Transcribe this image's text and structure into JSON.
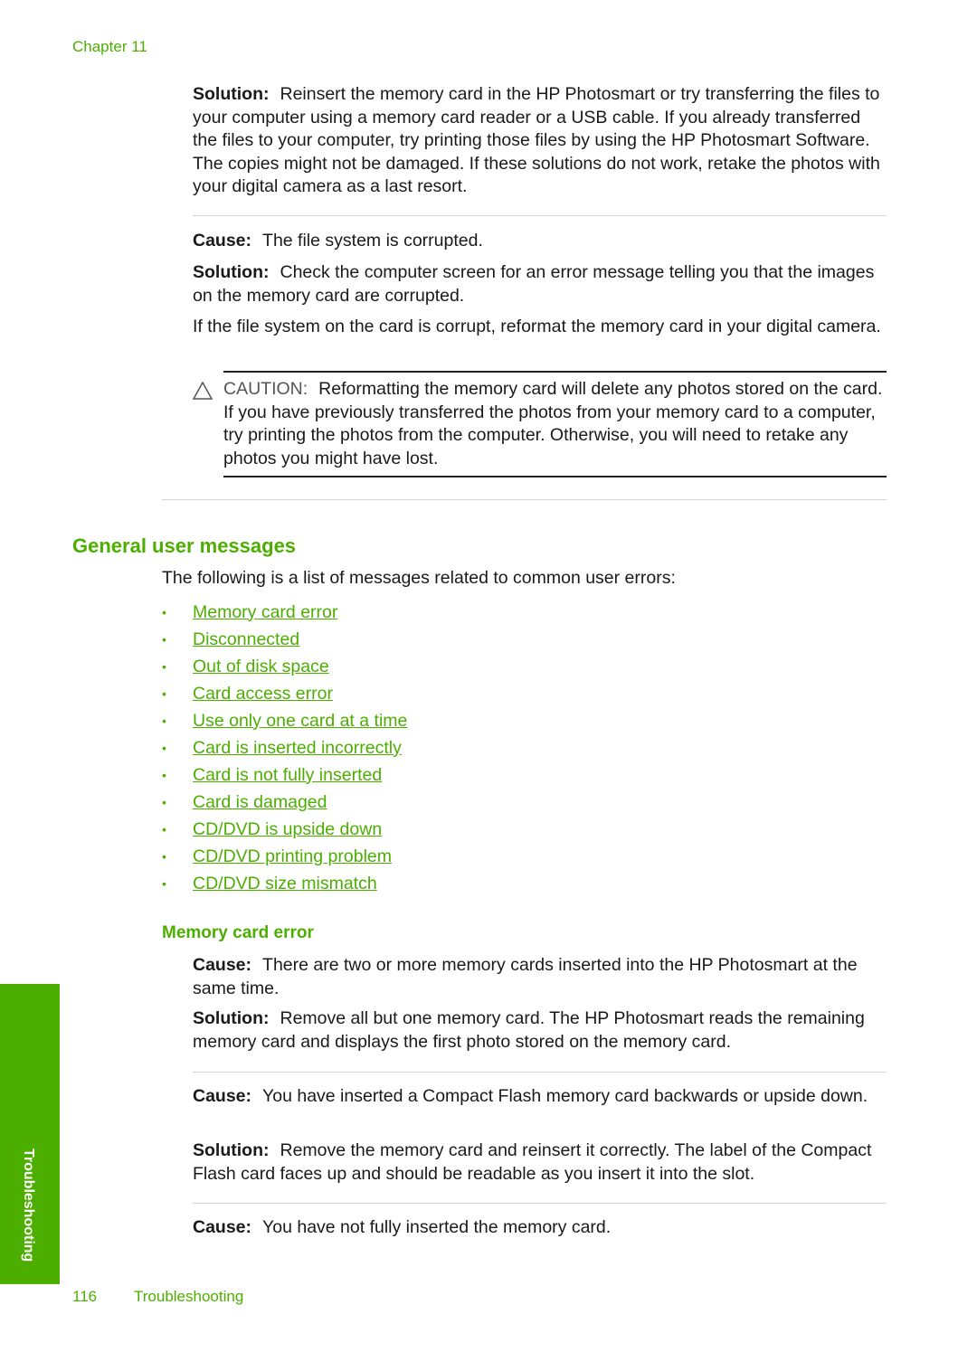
{
  "header": {
    "chapter": "Chapter 11"
  },
  "top_solution": {
    "label": "Solution:",
    "text": "Reinsert the memory card in the HP Photosmart or try transferring the files to your computer using a memory card reader or a USB cable. If you already transferred the files to your computer, try printing those files by using the HP Photosmart Software. The copies might not be damaged. If these solutions do not work, retake the photos with your digital camera as a last resort."
  },
  "cause2": {
    "label": "Cause:",
    "text": "The file system is corrupted."
  },
  "solution2": {
    "label": "Solution:",
    "text": "Check the computer screen for an error message telling you that the images on the memory card are corrupted."
  },
  "solution2_extra": "If the file system on the card is corrupt, reformat the memory card in your digital camera.",
  "caution": {
    "icon": "warning-triangle-icon",
    "label": "CAUTION:",
    "text": "Reformatting the memory card will delete any photos stored on the card. If you have previously transferred the photos from your memory card to a computer, try printing the photos from the computer. Otherwise, you will need to retake any photos you might have lost."
  },
  "section": {
    "title": "General user messages",
    "intro": "The following is a list of messages related to common user errors:",
    "links": [
      "Memory card error",
      "Disconnected",
      "Out of disk space",
      "Card access error",
      "Use only one card at a time",
      "Card is inserted incorrectly",
      "Card is not fully inserted",
      "Card is damaged",
      "CD/DVD is upside down",
      "CD/DVD printing problem",
      "CD/DVD size mismatch"
    ]
  },
  "subsection": {
    "title": "Memory card error",
    "items": [
      {
        "cause_label": "Cause:",
        "cause": "There are two or more memory cards inserted into the HP Photosmart at the same time.",
        "solution_label": "Solution:",
        "solution": "Remove all but one memory card. The HP Photosmart reads the remaining memory card and displays the first photo stored on the memory card."
      },
      {
        "cause_label": "Cause:",
        "cause": "You have inserted a Compact Flash memory card backwards or upside down.",
        "solution_label": "Solution:",
        "solution": "Remove the memory card and reinsert it correctly. The label of the Compact Flash card faces up and should be readable as you insert it into the slot."
      },
      {
        "cause_label": "Cause:",
        "cause": "You have not fully inserted the memory card."
      }
    ]
  },
  "side_tab": "Troubleshooting",
  "footer": {
    "page_number": "116",
    "section": "Troubleshooting"
  },
  "colors": {
    "accent": "#4caf00"
  }
}
